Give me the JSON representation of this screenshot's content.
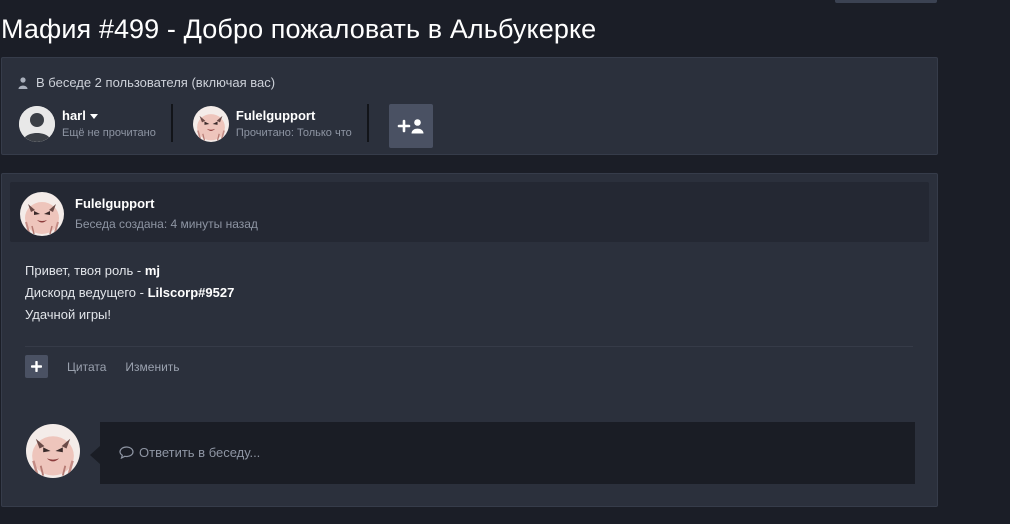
{
  "page": {
    "title": "Мафия #499 - Добро пожаловать в Альбукерке"
  },
  "participants": {
    "count_text": "В беседе 2 пользователя (включая вас)",
    "list": [
      {
        "name": "harl",
        "status": "Ещё не прочитано",
        "avatar": "default-user-avatar",
        "has_menu": true
      },
      {
        "name": "Fulelgupport",
        "status": "Прочитано: Только что",
        "avatar": "pink-creature-avatar",
        "has_menu": false
      }
    ],
    "add_button_icon": "add-user-icon"
  },
  "message": {
    "author": "Fulelgupport",
    "created": "Беседа создана: 4 минуты назад",
    "lines": [
      {
        "prefix": "Привет, твоя роль - ",
        "bold": "mj"
      },
      {
        "prefix": "Дискорд ведущего - ",
        "bold": "Lilscorp#9527"
      },
      {
        "prefix": "Удачной игры!",
        "bold": ""
      }
    ],
    "actions": {
      "plus_icon": "plus-icon",
      "quote": "Цитата",
      "edit": "Изменить"
    }
  },
  "reply": {
    "placeholder": "Ответить в беседу..."
  },
  "colors": {
    "background": "#1b1e27",
    "panel": "#2b303c",
    "header": "#242833",
    "accent_button": "#4a5163"
  }
}
